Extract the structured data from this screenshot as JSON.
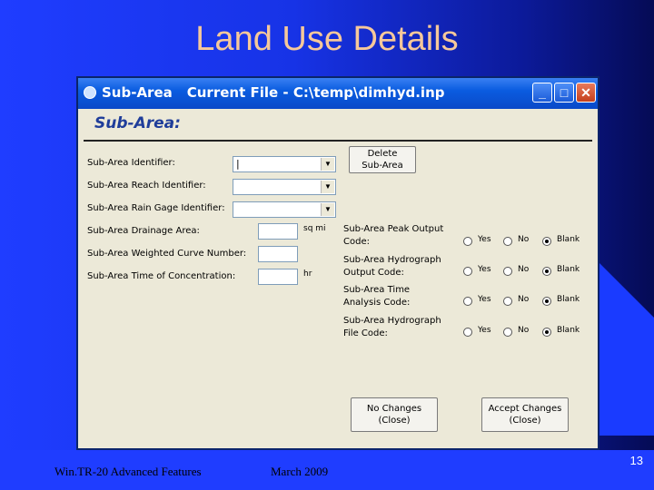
{
  "slide": {
    "title": "Land Use Details",
    "footer_left": "Win.TR-20 Advanced Features",
    "footer_date": "March 2009",
    "page_number": "13"
  },
  "window": {
    "title": "Sub-Area",
    "file_label": "Current File - C:\\temp\\dimhyd.inp",
    "minimize": "_",
    "maximize": "□",
    "close": "✕"
  },
  "form": {
    "section_title": "Sub-Area:",
    "fields": {
      "identifier": "Sub-Area Identifier:",
      "reach_identifier": "Sub-Area Reach Identifier:",
      "rain_gage_identifier": "Sub-Area Rain Gage Identifier:",
      "drainage_area": "Sub-Area Drainage Area:",
      "curve_number": "Sub-Area Weighted Curve Number:",
      "time_of_concentration": "Sub-Area Time of Concentration:"
    },
    "values": {
      "identifier": "|",
      "reach_identifier": "",
      "rain_gage_identifier": "",
      "drainage_area": "",
      "curve_number": "",
      "time_of_concentration": ""
    },
    "units": {
      "drainage_area": "sq mi",
      "time_of_concentration": "hr"
    },
    "delete_button": [
      "Delete",
      "Sub-Area"
    ],
    "options": [
      {
        "label": [
          "Sub-Area Peak Output",
          "Code:"
        ],
        "yes": "Yes",
        "no": "No",
        "blank": "Blank",
        "selected": "Blank"
      },
      {
        "label": [
          "Sub-Area Hydrograph",
          "Output Code:"
        ],
        "yes": "Yes",
        "no": "No",
        "blank": "Blank",
        "selected": "Blank"
      },
      {
        "label": [
          "Sub-Area Time",
          "Analysis Code:"
        ],
        "yes": "Yes",
        "no": "No",
        "blank": "Blank",
        "selected": "Blank"
      },
      {
        "label": [
          "Sub-Area Hydrograph",
          "File Code:"
        ],
        "yes": "Yes",
        "no": "No",
        "blank": "Blank",
        "selected": "Blank"
      }
    ],
    "no_changes_button": [
      "No Changes",
      "(Close)"
    ],
    "accept_changes_button": [
      "Accept Changes",
      "(Close)"
    ]
  }
}
